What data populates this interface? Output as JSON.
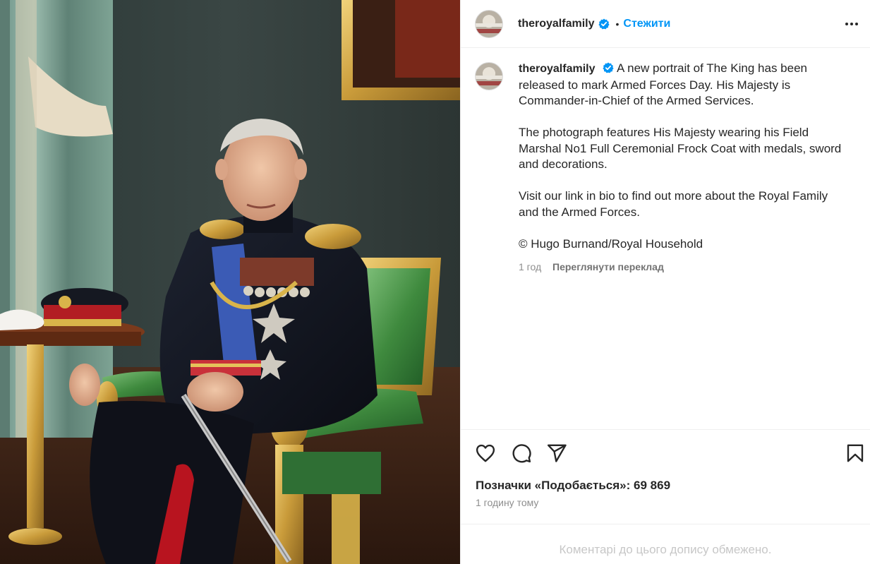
{
  "post": {
    "username": "theroyalfamily",
    "follow_label": "Стежити",
    "separator": "•",
    "caption_paragraphs": [
      "A new portrait of The King has been released to mark Armed Forces Day. His Majesty is Commander-in-Chief of the Armed Services.",
      "The photograph features His Majesty wearing his Field Marshal No1 Full Ceremonial Frock Coat with medals, sword and decorations.",
      "Visit our link in bio to find out more about the Royal Family and the Armed Forces.",
      "© Hugo Burnand/Royal Household"
    ],
    "caption_age": "1 год",
    "see_translation": "Переглянути переклад",
    "likes_label": "Позначки «Подобається»: 69 869",
    "posted_time": "1 годину тому",
    "comments_limited": "Коментарі до цього допису обмежено."
  },
  "icons": {
    "verified": "verified-badge-icon",
    "more": "more-options-icon",
    "like": "heart-icon",
    "comment": "comment-icon",
    "share": "paper-plane-icon",
    "save": "bookmark-icon"
  },
  "colors": {
    "accent": "#0095f6",
    "text": "#262626",
    "muted": "#8e8e8e",
    "border": "#efefef"
  }
}
